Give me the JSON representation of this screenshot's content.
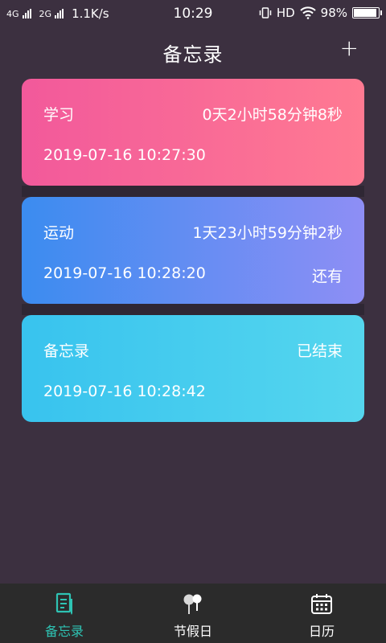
{
  "status_bar": {
    "network1": "4G",
    "network2": "2G",
    "speed": "1.1K/s",
    "time": "10:29",
    "hd": "HD",
    "battery_percent": "98%",
    "battery_level": 0.98
  },
  "header": {
    "title": "备忘录",
    "add_label": "+"
  },
  "memos": [
    {
      "title": "学习",
      "countdown": "0天2小时58分钟8秒",
      "datetime": "2019-07-16 10:27:30",
      "status": ""
    },
    {
      "title": "运动",
      "countdown": "1天23小时59分钟2秒",
      "datetime": "2019-07-16 10:28:20",
      "status": "还有"
    },
    {
      "title": "备忘录",
      "countdown": "已结束",
      "datetime": "2019-07-16 10:28:42",
      "status": ""
    }
  ],
  "tabs": [
    {
      "label": "备忘录",
      "icon": "memo-icon",
      "active": true
    },
    {
      "label": "节假日",
      "icon": "holiday-icon",
      "active": false
    },
    {
      "label": "日历",
      "icon": "calendar-icon",
      "active": false
    }
  ],
  "colors": {
    "background": "#3c3040",
    "accent": "#2ec3b3",
    "card1": [
      "#f2599b",
      "#ff7a92"
    ],
    "card2": [
      "#3b8cf0",
      "#8e8ef5"
    ],
    "card3": [
      "#38c3ee",
      "#55d6ee"
    ]
  }
}
